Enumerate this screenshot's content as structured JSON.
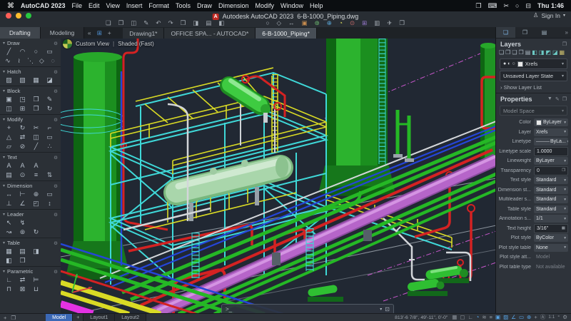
{
  "colors": {
    "vp-bg": "#212833",
    "frame-cyan": "#3fd8d8",
    "rail-yellow": "#d9da25",
    "pipe-red": "#d42222",
    "pipe-green": "#25b825",
    "pipe-violet": "#b665c9",
    "pipe-magenta": "#e332e3",
    "pipe-blue": "#2545d8",
    "pipe-white": "#d3d6da",
    "dash-magenta": "#c857cc",
    "accent-blue": "#3e76c2"
  },
  "menu_bar": {
    "apple_icon": "⌘",
    "items": [
      "AutoCAD 2023",
      "File",
      "Edit",
      "View",
      "Insert",
      "Format",
      "Tools",
      "Draw",
      "Dimension",
      "Modify",
      "Window",
      "Help"
    ],
    "status_icons": [
      {
        "name": "screen-mirroring-icon",
        "glyph": "❐"
      },
      {
        "name": "keyboard-icon",
        "glyph": "⌨"
      },
      {
        "name": "snip-icon",
        "glyph": "✂"
      },
      {
        "name": "spotlight-search-icon",
        "glyph": "○"
      },
      {
        "name": "control-center-icon",
        "glyph": "⊟"
      }
    ],
    "time": "Thu 1:46"
  },
  "title_bar": {
    "traffic_lights": [
      "#ff5f57",
      "#febc2e",
      "#28c840"
    ],
    "app_badge": "A",
    "title": "Autodesk AutoCAD 2023",
    "doc": "6-B-1000_Piping.dwg",
    "sign_in_icon": "♙",
    "sign_in": "Sign In",
    "sign_in_caret": "▾"
  },
  "qat": {
    "left": [
      {
        "name": "new-file-icon",
        "glyph": "❏"
      },
      {
        "name": "open-file-icon",
        "glyph": "❐"
      },
      {
        "name": "save-icon",
        "glyph": "◫"
      },
      {
        "name": "save-as-icon",
        "glyph": "✎"
      },
      {
        "name": "undo-icon",
        "glyph": "↶"
      },
      {
        "name": "redo-icon",
        "glyph": "↷"
      },
      {
        "name": "print-icon",
        "glyph": "❒"
      },
      {
        "name": "print-preview-icon",
        "glyph": "◨"
      },
      {
        "name": "page-setup-icon",
        "glyph": "▤"
      },
      {
        "name": "plot-style-icon",
        "glyph": "◧"
      }
    ],
    "right": [
      {
        "name": "zoom-window-icon",
        "glyph": "○"
      },
      {
        "name": "pan-icon",
        "glyph": "◇"
      },
      {
        "name": "zoom-extents-icon",
        "glyph": "↔"
      },
      {
        "name": "tool-sets-icon",
        "glyph": "▣",
        "tint": "#c98d4e"
      },
      {
        "name": "render-icon",
        "glyph": "⊛",
        "tint": "#6fbf73"
      },
      {
        "name": "geolocation-icon",
        "glyph": "⊕",
        "tint": "#5aa7d8"
      },
      {
        "name": "time-variables-icon",
        "glyph": "◔",
        "tint": "#d7d75a"
      },
      {
        "name": "materials-icon",
        "glyph": "⊙",
        "tint": "#c96a6a"
      },
      {
        "name": "layer-translator-icon",
        "glyph": "⊞",
        "tint": "#9a7ad0"
      },
      {
        "name": "attach-reference-icon",
        "glyph": "▥"
      },
      {
        "name": "share-icon",
        "glyph": "✈"
      },
      {
        "name": "copy-layout-icon",
        "glyph": "❐"
      }
    ]
  },
  "tab_bar": {
    "workspace_tabs": [
      {
        "label": "Drafting",
        "active": true
      },
      {
        "label": "Modeling",
        "active": false
      }
    ],
    "collapse_icon": "«",
    "grid_icon": "⊞",
    "add_tab_icon": "+",
    "doc_tabs": [
      {
        "label": "Drawing1*",
        "active": false
      },
      {
        "label": "OFFICE SPA... - AUTOCAD*",
        "active": false
      },
      {
        "label": "6-B-1000_Piping*",
        "active": true
      }
    ]
  },
  "palette": {
    "sections": [
      {
        "label": "Draw",
        "rows": [
          [
            "╱",
            "◠",
            "○",
            "▭"
          ],
          [
            "∿",
            "≀",
            "⋱",
            "◇",
            "◌"
          ]
        ]
      },
      {
        "label": "Hatch",
        "rows": [
          [
            "▨",
            "▧",
            "▦",
            "◪"
          ]
        ]
      },
      {
        "label": "Block",
        "rows": [
          [
            "▣",
            "◳",
            "❒",
            "✎"
          ],
          [
            "◫",
            "⊞",
            "❐",
            "↻"
          ]
        ]
      },
      {
        "label": "Modify",
        "rows": [
          [
            "+",
            "↻",
            "✂",
            "⌐"
          ],
          [
            "△",
            "⇄",
            "◫",
            "▭"
          ],
          [
            "▱",
            "⊘",
            "╱",
            "∴"
          ]
        ]
      },
      {
        "label": "Text",
        "rows": [
          [
            "A",
            "A",
            "A"
          ],
          [
            "▤",
            "⊙",
            "≡",
            "⇅"
          ]
        ]
      },
      {
        "label": "Dimension",
        "rows": [
          [
            "↔",
            "⊢",
            "⊕",
            "▭"
          ],
          [
            "⊥",
            "∠",
            "◰",
            "↕"
          ]
        ]
      },
      {
        "label": "Leader",
        "rows": [
          [
            "↖",
            "↯"
          ],
          [
            "↝",
            "⊛",
            "↻"
          ]
        ]
      },
      {
        "label": "Table",
        "rows": [
          [
            "▦",
            "▤",
            "◨"
          ],
          [
            "◧",
            "❒"
          ]
        ]
      },
      {
        "label": "Parametric",
        "rows": [
          [
            "∟",
            "⇄",
            "⊨"
          ],
          [
            "⊓",
            "⊠",
            "⊔"
          ]
        ]
      }
    ]
  },
  "viewport": {
    "view_label": {
      "nav_icon": "navigation-sphere-icon",
      "view": "Custom View",
      "separator": "|",
      "style": "Shaded (Fast)"
    },
    "command_bar": {
      "prompt": ">_",
      "value": "",
      "dropdown": "▾",
      "options_icon": "⊡"
    }
  },
  "layers_panel": {
    "tabs": [
      {
        "name": "tab-layers",
        "glyph": "❏",
        "active": true
      },
      {
        "name": "tab-sheet-sets",
        "glyph": "❐",
        "active": false
      },
      {
        "name": "tab-references",
        "glyph": "▤",
        "active": false
      }
    ],
    "overflow_icon": "»",
    "title": "Layers",
    "detach_icon": "❐",
    "tool_icons": [
      {
        "name": "new-layer-icon",
        "glyph": "❏"
      },
      {
        "name": "delete-layer-icon",
        "glyph": "❐"
      },
      {
        "name": "layer-states-icon",
        "glyph": "❑"
      },
      {
        "name": "layer-settings-icon",
        "glyph": "❒"
      },
      {
        "name": "layer-off-icon",
        "glyph": "▤"
      },
      {
        "name": "layer-freeze-icon",
        "glyph": "◧",
        "tint": "#6cc9c4"
      },
      {
        "name": "layer-lock-icon",
        "glyph": "◨",
        "tint": "#6cc9c4"
      },
      {
        "name": "layer-isolate-icon",
        "glyph": "◩",
        "tint": "#6cc9c4"
      },
      {
        "name": "layer-match-icon",
        "glyph": "◪",
        "tint": "#6cc9c4"
      },
      {
        "name": "layer-walk-icon",
        "glyph": "▦",
        "tint": "#c9bd6c"
      }
    ],
    "current_layer": {
      "dots": [
        "●",
        "◐",
        "○"
      ],
      "color_chip": "#e8e8e8",
      "name": "Xrefs",
      "caret": "▾"
    },
    "layer_state": "Unsaved Layer State",
    "show_list_chevron": "›",
    "show_list": "Show Layer List"
  },
  "properties_panel": {
    "title": "Properties",
    "header_icons": [
      {
        "name": "quick-select-icon",
        "glyph": "▼"
      },
      {
        "name": "match-properties-icon",
        "glyph": "✎"
      },
      {
        "name": "panel-detach-icon",
        "glyph": "❐"
      }
    ],
    "selection": "Model Space",
    "rows": [
      {
        "label": "Color",
        "value": "ByLayer",
        "kind": "drop",
        "chip": "#e8e8e8"
      },
      {
        "label": "Layer",
        "value": "Xrefs",
        "kind": "drop"
      },
      {
        "label": "Linetype",
        "value": "ByLa...",
        "kind": "drop",
        "line": true
      },
      {
        "label": "Linetype scale",
        "value": "1.0000",
        "kind": "input"
      },
      {
        "label": "Lineweight",
        "value": "ByLayer",
        "kind": "drop"
      },
      {
        "label": "Transparency",
        "value": "0",
        "kind": "transp"
      },
      {
        "label": "Text style",
        "value": "Standard",
        "kind": "drop"
      },
      {
        "label": "Dimension st...",
        "value": "Standard",
        "kind": "drop"
      },
      {
        "label": "Multileader s...",
        "value": "Standard",
        "kind": "drop"
      },
      {
        "label": "Table style",
        "value": "Standard",
        "kind": "drop"
      },
      {
        "label": "Annotation s...",
        "value": "1/1",
        "kind": "drop"
      },
      {
        "label": "Text height",
        "value": "3/16\"",
        "kind": "input",
        "trail": "▦"
      },
      {
        "label": "Plot style",
        "value": "ByColor",
        "kind": "drop"
      },
      {
        "label": "Plot style table",
        "value": "None",
        "kind": "drop"
      },
      {
        "label": "Plot style att...",
        "value": "Model",
        "kind": "disabled"
      },
      {
        "label": "Plot table type",
        "value": "Not available",
        "kind": "disabled"
      }
    ]
  },
  "status_bar": {
    "left_icons": [
      {
        "name": "status-add-icon",
        "glyph": "+"
      },
      {
        "name": "status-switch-icon",
        "glyph": "❐"
      }
    ],
    "model_tabs": [
      {
        "label": "Model",
        "active": true
      },
      {
        "label": "+",
        "add": true
      },
      {
        "label": "Layout1",
        "active": false
      },
      {
        "label": "Layout2",
        "active": false
      }
    ],
    "coordinates": "813'-6 7/8\", 49'-11\", 0'-0\"",
    "toggles": [
      {
        "glyph": "▦",
        "name": "grid-toggle",
        "active": false
      },
      {
        "glyph": "▢",
        "name": "snap-toggle",
        "active": false
      },
      {
        "glyph": "∟",
        "name": "ortho-toggle",
        "active": false
      },
      {
        "glyph": "◔",
        "name": "polar-tracking-toggle",
        "active": true
      },
      {
        "glyph": "≋",
        "name": "isodraft-toggle",
        "active": false
      },
      {
        "glyph": "≡",
        "name": "lineweight-toggle",
        "active": false
      },
      {
        "glyph": "▣",
        "name": "object-snap-toggle",
        "active": true
      },
      {
        "glyph": "▨",
        "name": "object-snap-3d-toggle",
        "active": true
      },
      {
        "glyph": "∠",
        "name": "snap-tracking-toggle",
        "active": true
      },
      {
        "glyph": "▭",
        "name": "dynamic-input-toggle",
        "active": true
      },
      {
        "glyph": "⊕",
        "name": "selection-cycling-toggle",
        "active": true
      },
      {
        "glyph": "+",
        "name": "gizmo-toggle",
        "active": false
      },
      {
        "glyph": "Ⓐ",
        "name": "annotation-visibility-toggle",
        "active": false
      },
      {
        "glyph": "1:1",
        "name": "annotation-scale-button",
        "active": false,
        "text": true
      },
      {
        "glyph": "°",
        "name": "units-button",
        "active": false
      },
      {
        "glyph": "⚙",
        "name": "customization-button",
        "active": false
      }
    ]
  }
}
